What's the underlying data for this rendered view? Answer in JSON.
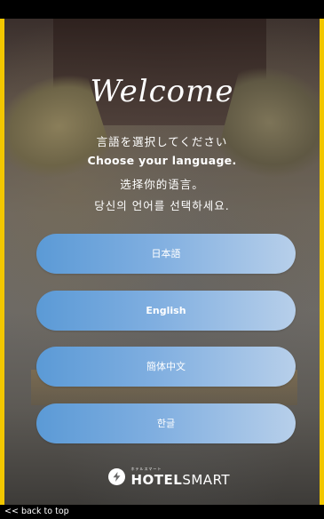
{
  "welcome_title": "Welcome",
  "prompts": {
    "japanese": "言語を選択してください",
    "english": "Choose your language.",
    "chinese": "选择你的语言。",
    "korean": "당신의 언어를 선택하세요."
  },
  "languages": [
    {
      "label": "日本語"
    },
    {
      "label": "English"
    },
    {
      "label": "簡体中文"
    },
    {
      "label": "한글"
    }
  ],
  "logo": {
    "small_text": "ホテルスマート",
    "hotel": "HOTEL",
    "smart": "SMART"
  },
  "footer": {
    "back_to_top": "<< back to top"
  },
  "colors": {
    "frame": "#f2c700",
    "button_start": "#5b9ad6",
    "button_end": "#b7cfea"
  }
}
